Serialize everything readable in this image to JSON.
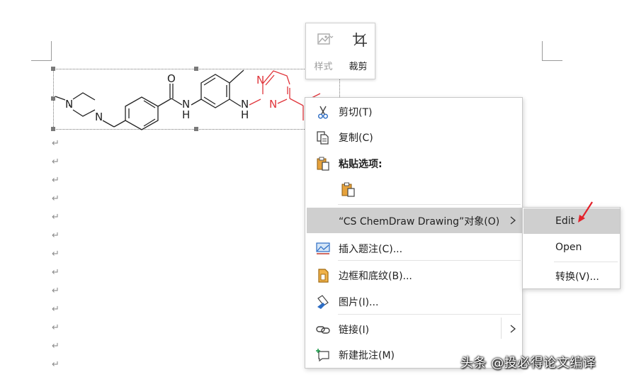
{
  "mini_toolbar": {
    "style_label": "样式",
    "crop_label": "裁剪"
  },
  "chem_structure": {
    "atoms": {
      "n1": "N",
      "n2": "N",
      "o": "O",
      "nh1_n": "N",
      "nh1_h": "H",
      "nh2_n": "N",
      "nh2_h": "H",
      "pyr_n1": "N",
      "pyr_n2": "N"
    }
  },
  "context_menu": {
    "cut": "剪切(T)",
    "copy": "复制(C)",
    "paste_options": "粘贴选项:",
    "object": "“CS ChemDraw Drawing”对象(O)",
    "insert_caption": "插入题注(C)...",
    "borders_shading": "边框和底纹(B)...",
    "picture": "图片(I)...",
    "link": "链接(I)",
    "new_comment": "新建批注(M)"
  },
  "submenu": {
    "edit": "Edit",
    "open": "Open",
    "convert": "转换(V)..."
  },
  "watermark": "头条 @投必得论文编译",
  "colors": {
    "highlight": "#cfcfcf",
    "pyrimidine_red": "#e0353b",
    "arrow_red": "#e3222b"
  }
}
